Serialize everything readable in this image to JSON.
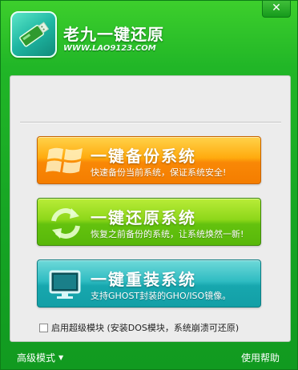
{
  "window": {
    "title": "老九一键还原",
    "url": "WWW.LAO9123.COM",
    "close_label": "✕"
  },
  "buttons": {
    "backup": {
      "title": "一键备份系统",
      "subtitle": "快速备份当前系统，保证系统安全!"
    },
    "restore": {
      "title": "一键还原系统",
      "subtitle": "恢复之前备份的系统，让系统焕然一新!"
    },
    "reinstall": {
      "title": "一键重装系统",
      "subtitle": "支持GHOST封装的GHO/ISO镜像。"
    }
  },
  "options": {
    "super_module": {
      "label": "启用超级模块 (安装DOS模块，系统崩溃可还原)",
      "checked": false
    }
  },
  "footer": {
    "advanced_mode": "高级模式",
    "help": "使用帮助"
  },
  "colors": {
    "frame_green": "#1aa52a",
    "backup_orange": "#f98806",
    "restore_green": "#64c20e",
    "reinstall_teal": "#17a7ae"
  }
}
